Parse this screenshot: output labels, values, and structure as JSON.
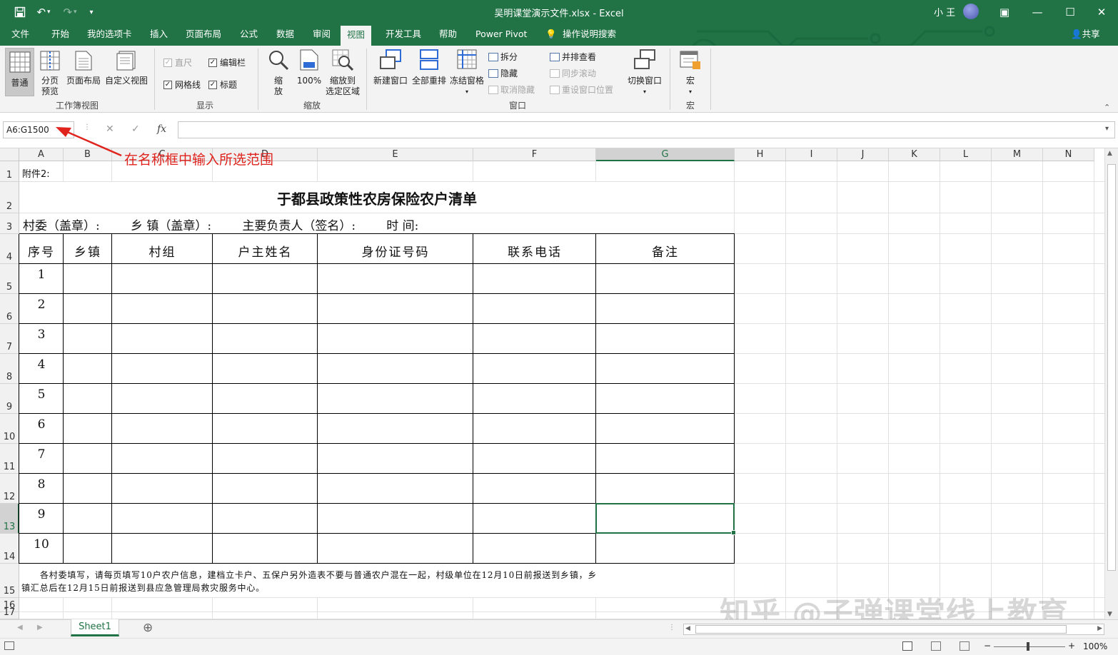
{
  "titlebar": {
    "title": "吴明课堂演示文件.xlsx  -  Excel",
    "user": "小 王",
    "save_icon": "save-icon",
    "undo_icon": "undo-icon",
    "redo_icon": "redo-icon",
    "minimize": "—",
    "restore": "☐",
    "close": "✕",
    "ribbon_display": "▣"
  },
  "tabs": {
    "file": "文件",
    "home": "开始",
    "mytab": "我的选项卡",
    "insert": "插入",
    "layout": "页面布局",
    "formula": "公式",
    "data": "数据",
    "review": "审阅",
    "view": "视图",
    "dev": "开发工具",
    "help": "帮助",
    "powerpivot": "Power Pivot",
    "tellme": "操作说明搜索",
    "share": "共享"
  },
  "ribbon": {
    "normal": "普通",
    "pagebreak_1": "分页",
    "pagebreak_2": "预览",
    "pagelayout": "页面布局",
    "customview": "自定义视图",
    "group_workbookview": "工作簿视图",
    "ruler": "直尺",
    "formulabar": "编辑栏",
    "gridlines": "网格线",
    "headings": "标题",
    "group_show": "显示",
    "zoom_1": "缩",
    "zoom_2": "放",
    "zoom100": "100%",
    "zoomsel_1": "缩放到",
    "zoomsel_2": "选定区域",
    "group_zoom": "缩放",
    "newwin": "新建窗口",
    "arrange": "全部重排",
    "freeze": "冻结窗格",
    "split": "拆分",
    "hide": "隐藏",
    "unhide": "取消隐藏",
    "sidebyside": "并排查看",
    "syncscroll": "同步滚动",
    "resetpos": "重设窗口位置",
    "switchwin": "切换窗口",
    "group_window": "窗口",
    "macro": "宏",
    "group_macro": "宏"
  },
  "formula_bar": {
    "name_box": "A6:G1500",
    "cancel": "✕",
    "enter": "✓",
    "fx": "fx",
    "value": ""
  },
  "annotation": "在名称框中输入所选范围",
  "columns": [
    "A",
    "B",
    "C",
    "D",
    "E",
    "F",
    "G",
    "H",
    "I",
    "J",
    "K",
    "L",
    "M",
    "N"
  ],
  "rows": [
    "1",
    "2",
    "3",
    "4",
    "5",
    "6",
    "7",
    "8",
    "9",
    "10",
    "11",
    "12",
    "13",
    "14",
    "15",
    "16",
    "17"
  ],
  "sheet": {
    "a1": "附件2:",
    "title": "于都县政策性农房保险农户清单",
    "row3": "村委（盖章）:        乡 镇（盖章）:        主要负责人（签名）:        时 间:",
    "headers": [
      "序号",
      "乡镇",
      "村组",
      "户主姓名",
      "身份证号码",
      "联系电话",
      "备注"
    ],
    "serials": [
      "1",
      "2",
      "3",
      "4",
      "5",
      "6",
      "7",
      "8",
      "9",
      "10"
    ],
    "note_line1": "各村委填写，请每页填写10户农户信息，建档立卡户、五保户另外造表不要与普通农户混在一起，村级单位在12月10日前报送到乡镇，乡",
    "note_line2": "镇汇总后在12月15日前报送到县应急管理局救灾服务中心。"
  },
  "sheet_tabs": {
    "active": "Sheet1",
    "add": "⊕"
  },
  "status": {
    "zoom": "100%",
    "minus": "−",
    "plus": "+"
  },
  "watermark": "知乎 @子弹课堂线上教育",
  "colors": {
    "accent": "#217346",
    "annotation": "#e0231d"
  }
}
